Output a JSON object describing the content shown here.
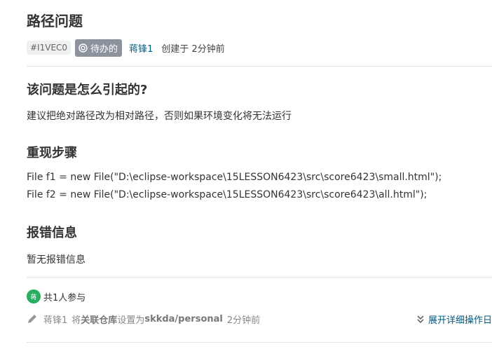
{
  "issue": {
    "title": "路径问题",
    "id": "#I1VEC0",
    "state": "待办的",
    "author": "蒋锋1",
    "created": "创建于 2分钟前"
  },
  "sections": {
    "cause_heading": "该问题是怎么引起的?",
    "cause_text": "建议把绝对路径改为相对路径，否则如果环境变化将无法运行",
    "steps_heading": "重现步骤",
    "steps_line1": "File f1 = new File(\"D:\\eclipse-workspace\\15LESSON6423\\src\\score6423\\small.html\");",
    "steps_line2": "File f2 = new File(\"D:\\eclipse-workspace\\15LESSON6423\\src\\score6423\\all.html\");",
    "error_heading": "报错信息",
    "error_text": "暂无报错信息"
  },
  "footer": {
    "avatar_initial": "蒋",
    "participants": "共1人参与",
    "activity_user": "蒋锋1",
    "activity_action": "将",
    "activity_field": "关联仓库",
    "activity_set": "设置为",
    "activity_value": "skkda/personal",
    "activity_time": "2分钟前",
    "expand_label": "展开详细操作日"
  },
  "colors": {
    "state_badge": "#8d939c",
    "link": "#005980",
    "avatar": "#27ae60"
  },
  "icons": [
    "state-circle-icon",
    "edit-pencil-icon",
    "double-chevron-down-icon"
  ]
}
